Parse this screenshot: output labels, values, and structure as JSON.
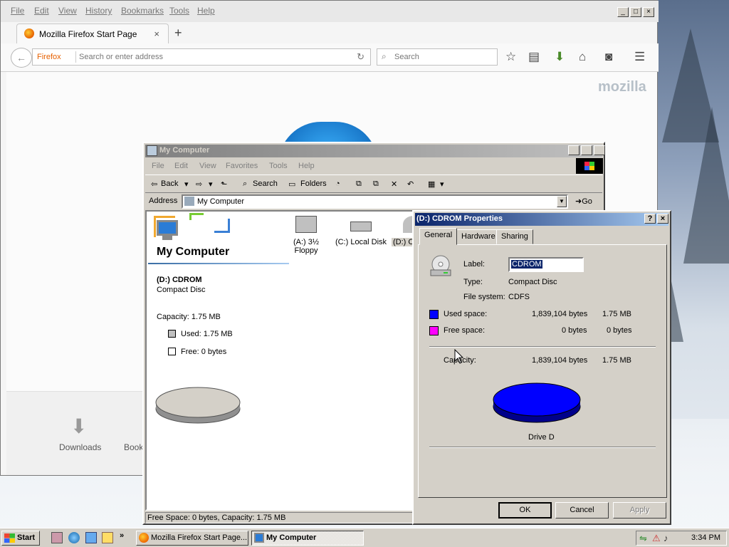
{
  "firefox": {
    "menu": [
      "File",
      "Edit",
      "View",
      "History",
      "Bookmarks",
      "Tools",
      "Help"
    ],
    "tab_title": "Mozilla Firefox Start Page",
    "tab_close": "×",
    "new_tab": "+",
    "identity_label": "Firefox",
    "url_placeholder": "Search or enter address",
    "search_placeholder": "Search",
    "brand": "mozilla",
    "bottom_items": [
      "Downloads",
      "Book"
    ],
    "toolbar_icons": [
      "star-icon",
      "reading-list-icon",
      "download-icon",
      "home-icon",
      "pocket-icon",
      "menu-icon"
    ]
  },
  "my_computer": {
    "title": "My Computer",
    "menu": [
      "File",
      "Edit",
      "View",
      "Favorites",
      "Tools",
      "Help"
    ],
    "toolbar": {
      "back": "Back",
      "search": "Search",
      "folders": "Folders"
    },
    "address_label": "Address",
    "address_value": "My Computer",
    "go_label": "Go",
    "header": "My Computer",
    "selected_drive": {
      "name": "(D:) CDROM",
      "type": "Compact Disc",
      "capacity": "Capacity: 1.75 MB",
      "used": "Used: 1.75 MB",
      "free": "Free: 0 bytes"
    },
    "items": [
      {
        "line1": "(A:) 3½",
        "line2": "Floppy"
      },
      {
        "line1": "(C:) Local Disk",
        "line2": ""
      },
      {
        "line1": "(D:) C",
        "line2": ""
      }
    ],
    "status": "Free Space: 0 bytes, Capacity: 1.75 MB",
    "colors": {
      "used": "#c0c0c0",
      "free": "#ffffff"
    }
  },
  "properties": {
    "title": "(D:) CDROM Properties",
    "help": "?",
    "close": "×",
    "tabs": [
      "General",
      "Hardware",
      "Sharing"
    ],
    "label_caption": "Label:",
    "label_value": "CDROM",
    "type_caption": "Type:",
    "type_value": "Compact Disc",
    "fs_caption": "File system:",
    "fs_value": "CDFS",
    "used_caption": "Used space:",
    "used_bytes": "1,839,104 bytes",
    "used_mb": "1.75 MB",
    "free_caption": "Free space:",
    "free_bytes": "0 bytes",
    "free_mb": "0 bytes",
    "capacity_caption": "Capacity:",
    "capacity_bytes": "1,839,104 bytes",
    "capacity_mb": "1.75 MB",
    "drive_label": "Drive D",
    "buttons": {
      "ok": "OK",
      "cancel": "Cancel",
      "apply": "Apply"
    },
    "colors": {
      "used": "#0000ff",
      "free": "#ff00ff"
    }
  },
  "taskbar": {
    "start": "Start",
    "tasks": [
      "Mozilla Firefox Start Page...",
      "My Computer"
    ],
    "clock": "3:34 PM"
  }
}
